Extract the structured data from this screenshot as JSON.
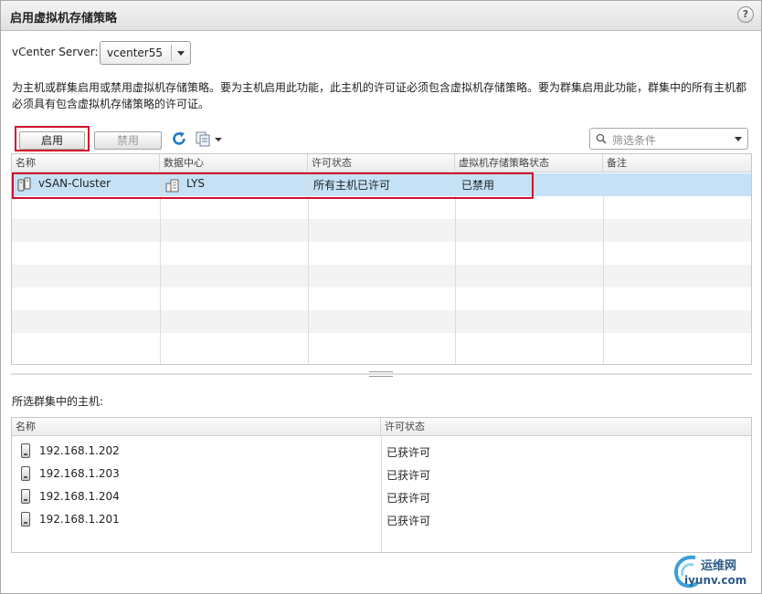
{
  "dialog": {
    "title": "启用虚拟机存储策略",
    "help_glyph": "?"
  },
  "vcenter": {
    "label": "vCenter Server:",
    "value": "vcenter55"
  },
  "description": "为主机或群集启用或禁用虚拟机存储策略。要为主机启用此功能，此主机的许可证必须包含虚拟机存储策略。要为群集启用此功能，群集中的所有主机都必须具有包含虚拟机存储策略的许可证。",
  "toolbar": {
    "enable_label": "启用",
    "disable_label": "禁用",
    "refresh_icon": "refresh-icon",
    "export_icon": "export-icon"
  },
  "filter": {
    "placeholder": "筛选条件"
  },
  "clusters_table": {
    "columns": [
      "名称",
      "数据中心",
      "许可状态",
      "虚拟机存储策略状态",
      "备注"
    ],
    "rows": [
      {
        "name": "vSAN-Cluster",
        "datacenter": "LYS",
        "license": "所有主机已许可",
        "policy_status": "已禁用",
        "notes": ""
      }
    ]
  },
  "hosts": {
    "title": "所选群集中的主机:",
    "columns": [
      "名称",
      "许可状态"
    ],
    "rows": [
      {
        "name": "192.168.1.202",
        "license": "已获许可"
      },
      {
        "name": "192.168.1.203",
        "license": "已获许可"
      },
      {
        "name": "192.168.1.204",
        "license": "已获许可"
      },
      {
        "name": "192.168.1.201",
        "license": "已获许可"
      }
    ]
  },
  "watermark": {
    "line1": "运维网",
    "line2": "iyunv.com"
  },
  "colors": {
    "highlight": "#d0112b",
    "selection": "#c4e1f6",
    "refresh": "#2a7ac0"
  }
}
